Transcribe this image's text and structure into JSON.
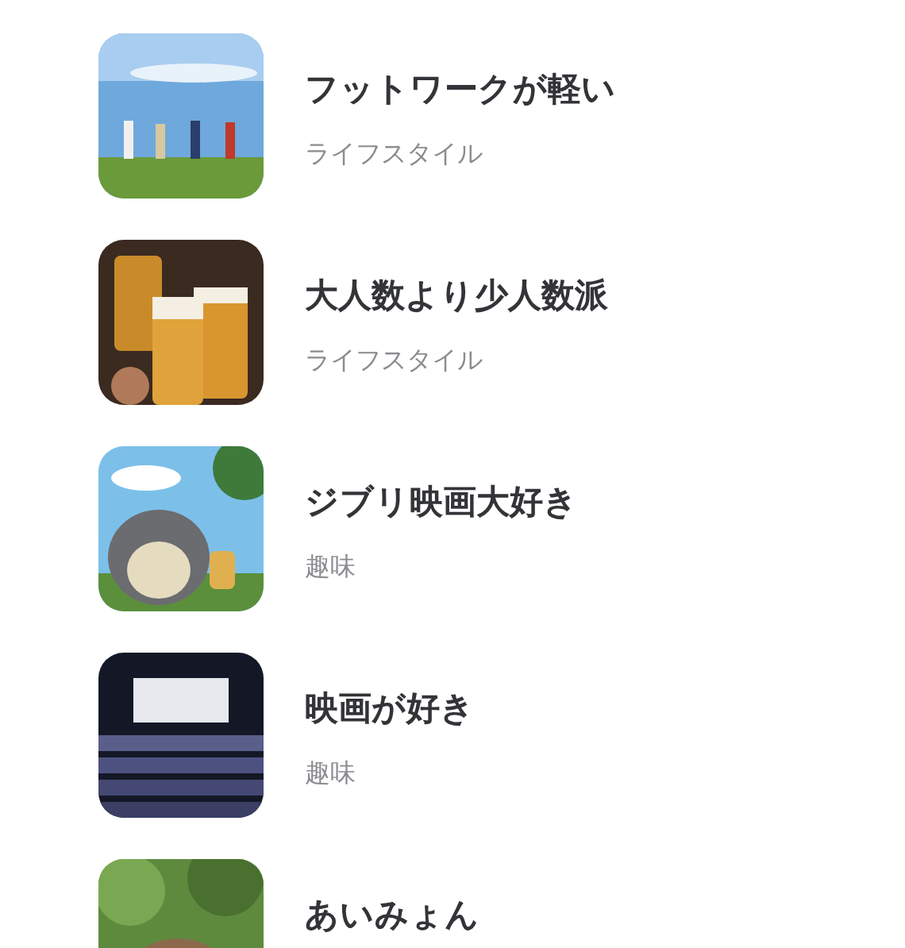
{
  "items": [
    {
      "title": "フットワークが軽い",
      "category": "ライフスタイル"
    },
    {
      "title": "大人数より少人数派",
      "category": "ライフスタイル"
    },
    {
      "title": "ジブリ映画大好き",
      "category": "趣味"
    },
    {
      "title": "映画が好き",
      "category": "趣味"
    },
    {
      "title": "あいみょん"
    }
  ]
}
